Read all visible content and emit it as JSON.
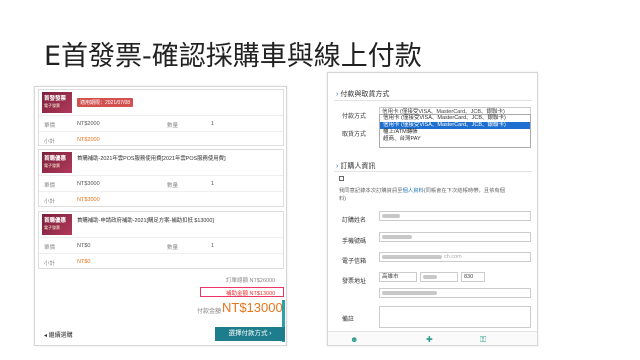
{
  "slide": {
    "title": "E首發票-確認採購車與線上付款"
  },
  "cart": {
    "items": [
      {
        "thumb_title": "首發發票",
        "thumb_sub": "電子發票",
        "name": "",
        "badge": "適用期限：2021/07/08",
        "unit_label": "單價",
        "unit_value": "NT$2000",
        "qty_label": "數量",
        "qty_value": "1",
        "subtotal_label": "小計",
        "subtotal_value": "NT$2000"
      },
      {
        "thumb_title": "首購優惠",
        "thumb_sub": "電子發票",
        "name": "首購補助-2021年雲POS服務使用費[2021年雲POS服務使用費]",
        "badge": "",
        "unit_label": "單價",
        "unit_value": "NT$3000",
        "qty_label": "數量",
        "qty_value": "1",
        "subtotal_label": "小計",
        "subtotal_value": "NT$3000"
      },
      {
        "thumb_title": "首購優惠",
        "thumb_sub": "電子發票",
        "name": "首購補助-申請政府補助-2021[購足方案-補助扣抵 $13000]",
        "badge": "",
        "unit_label": "單價",
        "unit_value": "NT$0",
        "qty_label": "數量",
        "qty_value": "1",
        "subtotal_label": "小計",
        "subtotal_value": "NT$0"
      }
    ],
    "order_total": "訂單總額 NT$26000",
    "subsidy": "補助金額 NT$13000",
    "pay_label": "付款金額",
    "pay_amount": "NT$13000",
    "back_label": "◂ 繼續選購",
    "choose_payment_label": "選擇付款方式 ›"
  },
  "form": {
    "payment_section": {
      "title": "付款與取貨方式",
      "pay_method_label": "付款方式",
      "pay_method_value": "信用卡 (僅接受VISA、MasterCard、JCB、銀聯卡)",
      "pickup_label": "取貨方式",
      "options": [
        "信用卡 (僅接受VISA、MasterCard、JCB、銀聯卡)",
        "信用卡 (僅接受VISA、MasterCard、JCB、銀聯卡)",
        "ATM轉帳",
        "超商、台灣PAY"
      ],
      "options_prefix": [
        "",
        "",
        "櫃上/",
        ""
      ]
    },
    "orderer_section": {
      "title": "訂購人資訊",
      "note_line1_a": "我同意記錄本次訂購資訊至",
      "note_line1_link": "個人資料",
      "note_line1_b": "(同帳會在下次結帳時帶，且依有個",
      "note_line2": "料)",
      "name_label": "訂購姓名",
      "phone_label": "手機號碼",
      "email_label": "電子信箱",
      "email_value": "ch.com",
      "address_label": "發票地址",
      "city_value": "高雄市",
      "postal_value": "830",
      "remark_label": "備註"
    },
    "bottom_icons": [
      "person-icon",
      "plus-icon",
      "key-icon"
    ]
  },
  "colors": {
    "accent_teal": "#1d7d8c",
    "price_orange": "#e5761e",
    "badge_red": "#d2514f",
    "select_blue": "#1f6fd1"
  }
}
